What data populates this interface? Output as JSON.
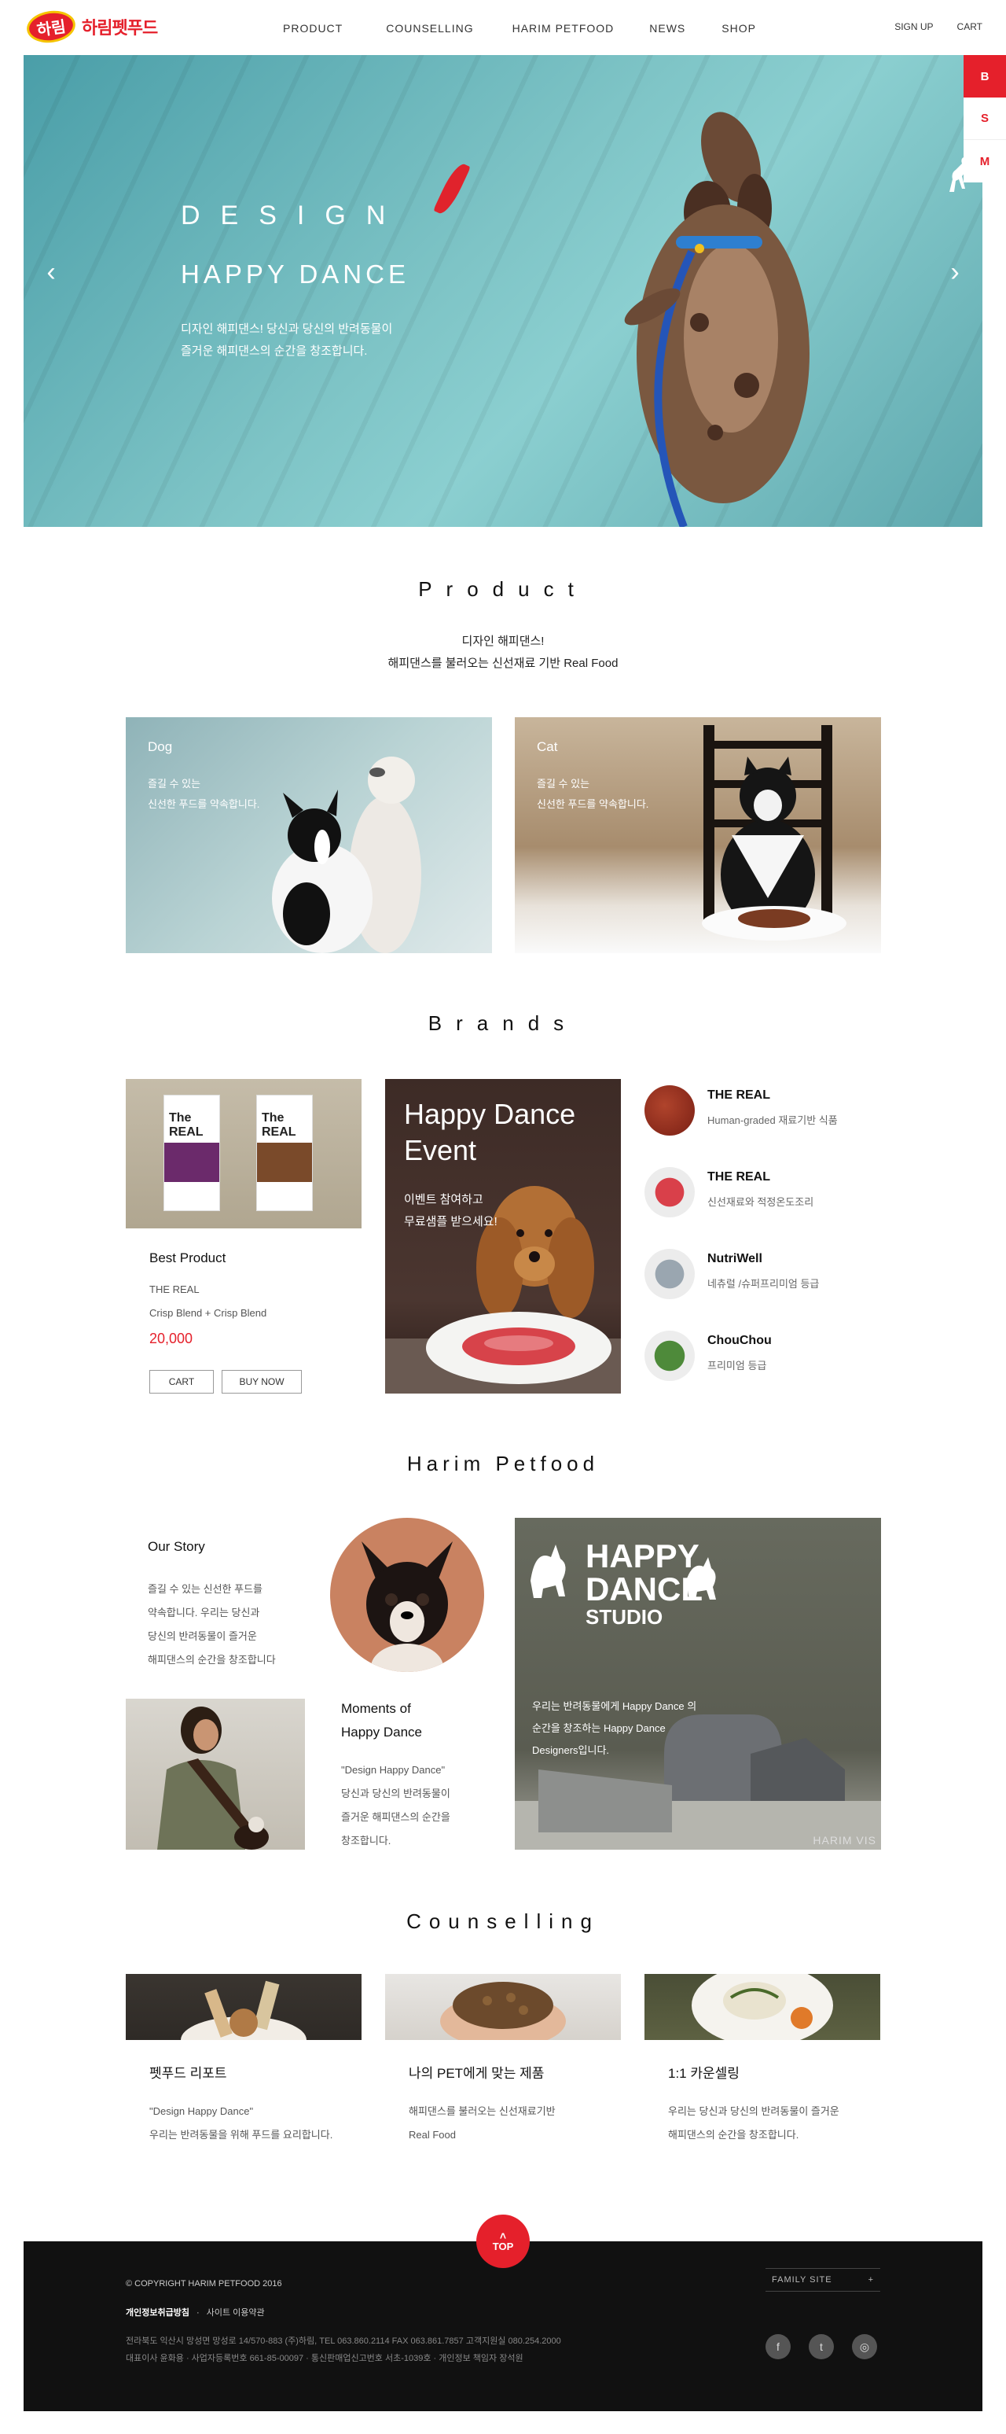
{
  "header": {
    "logo_badge": "하림",
    "logo_text": "하림펫푸드",
    "nav": [
      "PRODUCT",
      "COUNSELLING",
      "HARIM PETFOOD",
      "NEWS",
      "SHOP"
    ],
    "util": [
      "SIGN UP",
      "CART"
    ]
  },
  "hero": {
    "title1": "DESIGN",
    "title2": "HAPPY DANCE",
    "desc1": "디자인 해피댄스!  당신과 당신의 반려동물이",
    "desc2": "즐거운 해피댄스의 순간을 창조합니다.",
    "prev": "‹",
    "next": "›",
    "bg_color": "#6fb8bd"
  },
  "side_tabs": [
    "B",
    "S",
    "M"
  ],
  "product": {
    "title": "Product",
    "sub1": "디자인 해피댄스!",
    "sub2": "해피댄스를 불러오는 신선재료 기반 Real Food",
    "cards": [
      {
        "title": "Dog",
        "desc1": "즐길 수 있는",
        "desc2": "신선한 푸드를 약속합니다."
      },
      {
        "title": "Cat",
        "desc1": "즐길 수 있는",
        "desc2": "신선한 푸드를 약속합니다."
      }
    ]
  },
  "brands": {
    "title": "Brands",
    "bag_brand": "The REAL",
    "best": {
      "title": "Best Product",
      "brand": "THE REAL",
      "blend": "Crisp Blend + Crisp Blend",
      "price": "20,000",
      "cart": "CART",
      "buy": "BUY NOW"
    },
    "event": {
      "title1": "Happy Dance",
      "title2": "Event",
      "desc1": "이벤트 참여하고",
      "desc2": "무료샘플 받으세요!"
    },
    "list": [
      {
        "name": "THE REAL",
        "desc": "Human-graded 재료기반 식품",
        "color": "#8a2a1c"
      },
      {
        "name": "THE REAL",
        "desc": "신선재료와 적정온도조리",
        "color": "#c9313a"
      },
      {
        "name": "NutriWell",
        "desc": "네츄럴 /슈퍼프리미엄 등급",
        "color": "#9aa6b0"
      },
      {
        "name": "ChouChou",
        "desc": "프리미엄 등급",
        "color": "#4e8a3a"
      }
    ]
  },
  "harim": {
    "title": "Harim Petfood",
    "story_title": "Our Story",
    "story_lines": [
      "즐길 수 있는 신선한 푸드를",
      "약속합니다.  우리는 당신과",
      "당신의 반려동물이 즐거운",
      "해피댄스의 순간을 창조합니다"
    ],
    "moments_title1": "Moments of",
    "moments_title2": "Happy Dance",
    "moments_lines": [
      "\"Design Happy Dance\"",
      "당신과 당신의 반려동물이",
      "즐거운 해피댄스의 순간을",
      "창조합니다."
    ],
    "studio_title": [
      "HAPPY",
      "DANCE",
      "STUDIO"
    ],
    "studio_lines": [
      "우리는 반려동물에게 Happy Dance 의",
      "순간을 창조하는 Happy Dance",
      "Designers입니다."
    ],
    "studio_mark": "HARIM VIS"
  },
  "counselling": {
    "title": "Counselling",
    "cards": [
      {
        "title": "펫푸드 리포트",
        "desc1": "\"Design Happy Dance\"",
        "desc2": "우리는 반려동물을 위해 푸드를 요리합니다."
      },
      {
        "title": "나의 PET에게 맞는 제품",
        "desc1": "해피댄스를 불러오는 신선재료기반",
        "desc2": "Real Food"
      },
      {
        "title": "1:1 카운셀링",
        "desc1": "우리는 당신과 당신의 반려동물이 즐거운",
        "desc2": "해피댄스의 순간을 창조합니다."
      }
    ]
  },
  "footer": {
    "top_arrow": "˄",
    "top": "TOP",
    "copyright": "© COPYRIGHT HARIM PETFOOD 2016",
    "privacy": "개인정보취급방침",
    "terms": "사이트 이용약관",
    "addr1": "전라북도 익산시 망성면 망성로 14/570-883 (주)하림,  TEL 063.860.2114   FAX 063.861.7857 고객지원실 080.254.2000",
    "addr2": "대표이사  윤화용  ·  사업자등록번호  661-85-00097  ·  통신판매업신고번호  서초-1039호  ·  개인정보 책임자  장석원",
    "family_site": "FAMILY SITE",
    "family_plus": "+",
    "sns": [
      "f",
      "t",
      "◎"
    ]
  }
}
